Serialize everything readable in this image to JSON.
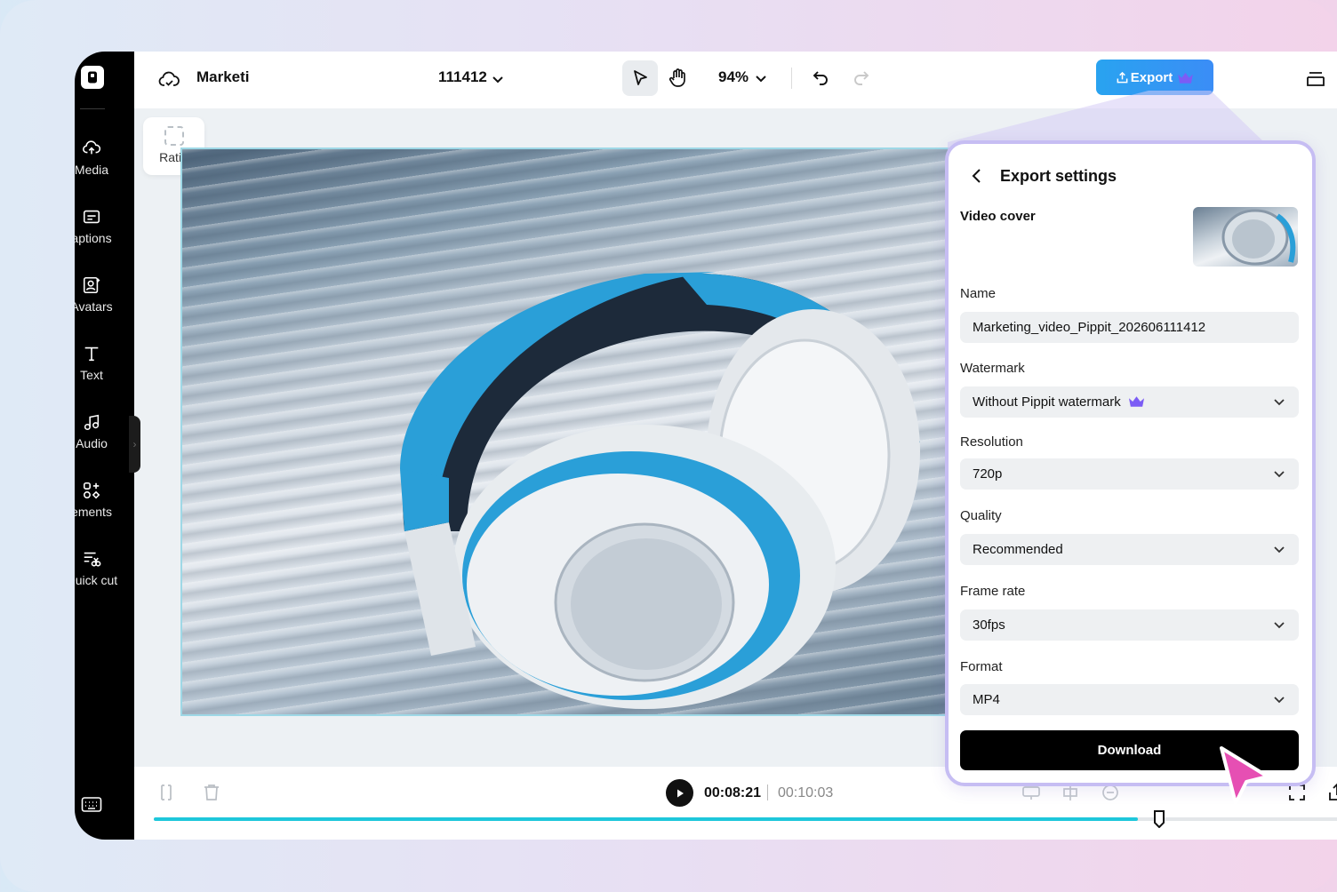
{
  "topbar": {
    "project_name": "Marketi",
    "project_id": "111412",
    "zoom": "94%",
    "export_label": "Export"
  },
  "sidebar": {
    "items": [
      {
        "label": "Media",
        "icon": "cloud-upload-icon"
      },
      {
        "label": "aptions",
        "icon": "captions-icon"
      },
      {
        "label": "Avatars",
        "icon": "avatar-icon"
      },
      {
        "label": "Text",
        "icon": "text-icon"
      },
      {
        "label": "Audio",
        "icon": "music-note-icon"
      },
      {
        "label": "ements",
        "icon": "elements-icon"
      },
      {
        "label": "Quick cut",
        "icon": "quick-cut-icon"
      }
    ]
  },
  "canvas": {
    "ratio_label": "Ratio"
  },
  "timeline": {
    "current_time": "00:08:21",
    "total_time": "00:10:03",
    "progress": 0.83
  },
  "export_panel": {
    "title": "Export settings",
    "video_cover_label": "Video cover",
    "name_label": "Name",
    "name_value": "Marketing_video_Pippit_202606111412",
    "watermark_label": "Watermark",
    "watermark_value": "Without Pippit watermark",
    "resolution_label": "Resolution",
    "resolution_value": "720p",
    "quality_label": "Quality",
    "quality_value": "Recommended",
    "frame_rate_label": "Frame rate",
    "frame_rate_value": "30fps",
    "format_label": "Format",
    "format_value": "MP4",
    "download_label": "Download"
  },
  "colors": {
    "accent": "#2f9af3",
    "premium": "#7b5cf5",
    "panel_border": "#c6bdf3",
    "progress": "#1ec7db",
    "cursor": "#e64fb3"
  }
}
